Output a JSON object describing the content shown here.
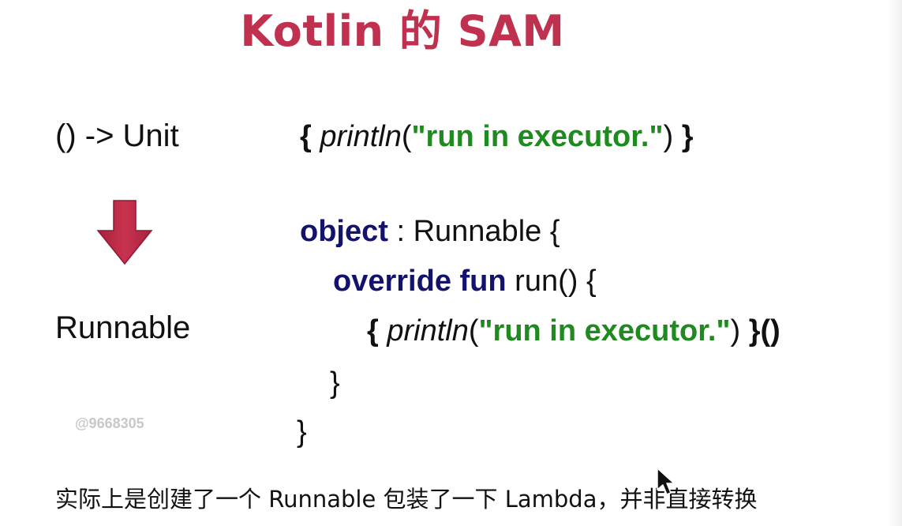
{
  "title": "Kotlin 的 SAM",
  "left": {
    "function_type": "() -> Unit",
    "interface": "Runnable",
    "arrow_icon": "arrow-down-icon",
    "arrow_color": "#c0314f"
  },
  "code": {
    "lambda": {
      "open": "{ ",
      "fn": "println",
      "paren_open": "(",
      "str": "\"run in executor.\"",
      "paren_close": ")",
      "close": " }"
    },
    "object_line": {
      "kw": "object",
      "rest": " : Runnable {"
    },
    "override_line": {
      "kw": "override fun",
      "rest": " run() {"
    },
    "inner_lambda": {
      "open": "{ ",
      "fn": "println",
      "paren_open": "(",
      "str": "\"run in executor.\"",
      "paren_close": ")",
      "close": " }()"
    },
    "close_inner": "}",
    "close_outer": "}"
  },
  "watermark": "@9668305",
  "caption": "实际上是创建了一个 Runnable 包装了一下 Lambda，并非直接转换",
  "colors": {
    "title": "#c0314f",
    "keyword": "#13136b",
    "string": "#1f8a1f"
  },
  "cursor_icon": "mouse-pointer-icon"
}
